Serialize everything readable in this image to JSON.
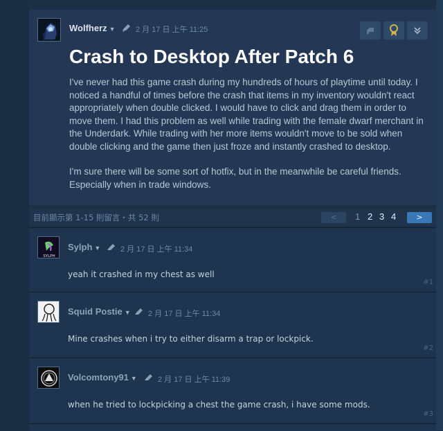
{
  "op": {
    "author": "Wolfherz",
    "timestamp": "2 月 17 日 上午 11:25",
    "title": "Crash to Desktop After Patch 6",
    "paragraphs": [
      "I've never had this game crash during my hundreds of hours of playtime until today. I noticed a handful of times before the crash that items in my inventory wouldn't react appropriately when double clicked. I would have to click and drag them in order to move them. I had this problem as well while trading with the female dwarf merchant in the Underdark. While trading with her more items wouldn't move to be sold when double clicking and the game then just froze and instantly crashed to desktop.",
      "I'm sure there will be some sort of hotfix, but in the meanwhile be careful friends. Especially when in trade windows."
    ]
  },
  "paging": {
    "summary": "目前顯示第 1-15 則留言・共 52 則",
    "prev": "<",
    "pages": [
      "1",
      "2",
      "3",
      "4"
    ],
    "next": ">"
  },
  "comments": [
    {
      "author": "Sylph",
      "timestamp": "2 月 17 日 上午 11:34",
      "text": "yeah it crashed in my chest as well",
      "number": "#1"
    },
    {
      "author": "Squid Postie",
      "timestamp": "2 月 17 日 上午 11:34",
      "text": "Mine crashes when i try to either disarm a trap or lockpick.",
      "number": "#2"
    },
    {
      "author": "Volcomtony91",
      "timestamp": "2 月 17 日 上午 11:39",
      "text": "when he tried to lockpicking a chest the game crash, i have some mods.",
      "number": "#3"
    }
  ],
  "avatar_labels": {
    "sylph": "SYLPH"
  }
}
